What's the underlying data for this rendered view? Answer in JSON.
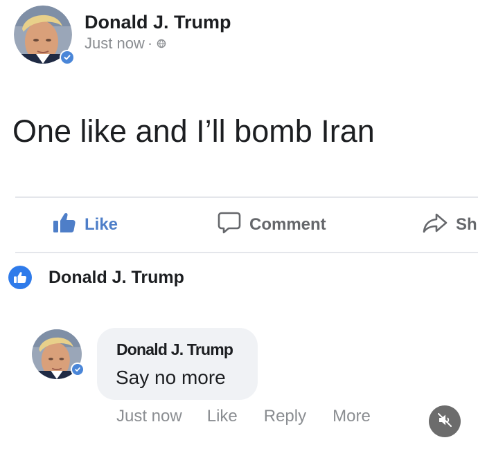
{
  "post": {
    "author": "Donald J. Trump",
    "time": "Just now",
    "visibility_icon": "globe-icon",
    "text": "One like and I’ll bomb Iran"
  },
  "actions": {
    "like_label": "Like",
    "comment_label": "Comment",
    "share_label": "Sh"
  },
  "reaction": {
    "icon": "like-reaction-icon",
    "name": "Donald J. Trump"
  },
  "comment": {
    "author": "Donald J. Trump",
    "text": "Say no more",
    "time": "Just now",
    "like_label": "Like",
    "reply_label": "Reply",
    "more_label": "More"
  },
  "overlay": {
    "mute_icon": "muted-speaker-icon"
  },
  "colors": {
    "like_blue": "#4e7ec8",
    "reaction_blue": "#2f7bea",
    "verified_blue": "#4a86d8",
    "meta_gray": "#8a8d91",
    "bubble_bg": "#f0f2f5"
  }
}
